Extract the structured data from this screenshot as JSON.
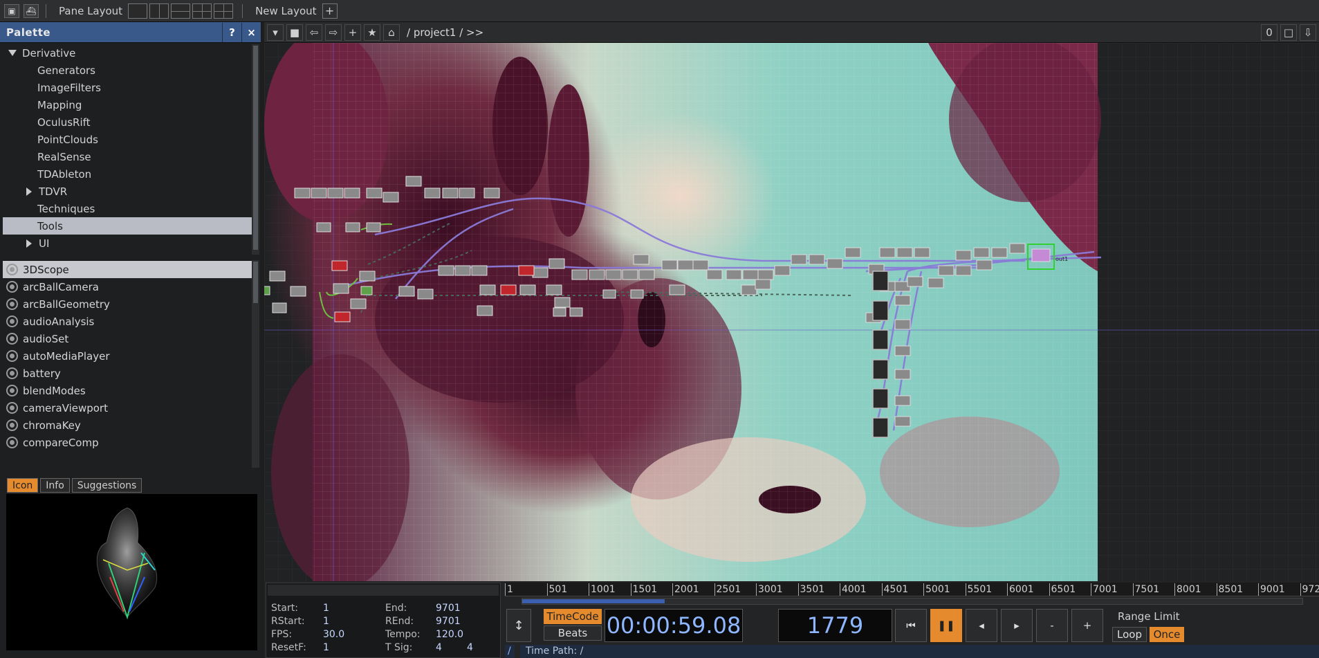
{
  "topbar": {
    "pane_layout_label": "Pane Layout",
    "new_layout_label": "New Layout"
  },
  "palette": {
    "title": "Palette",
    "help_label": "?",
    "close_label": "×",
    "tree": [
      {
        "label": "Derivative",
        "expanded": true
      },
      {
        "label": "Generators"
      },
      {
        "label": "ImageFilters"
      },
      {
        "label": "Mapping"
      },
      {
        "label": "OculusRift"
      },
      {
        "label": "PointClouds"
      },
      {
        "label": "RealSense"
      },
      {
        "label": "TDAbleton"
      },
      {
        "label": "TDVR",
        "collapsed": true
      },
      {
        "label": "Techniques"
      },
      {
        "label": "Tools",
        "selected": true
      },
      {
        "label": "UI",
        "collapsed": true
      }
    ],
    "components": [
      "3DScope",
      "arcBallCamera",
      "arcBallGeometry",
      "audioAnalysis",
      "audioSet",
      "autoMediaPlayer",
      "battery",
      "blendModes",
      "cameraViewport",
      "chromaKey",
      "compareComp"
    ],
    "selected_component": "3DScope",
    "info_tabs": [
      "Icon",
      "Info",
      "Suggestions"
    ],
    "active_info_tab": "Icon"
  },
  "network": {
    "path": "/ project1 / >>",
    "counter": "0",
    "output_label": "out1"
  },
  "timeline": {
    "start_label": "Start:",
    "start": "1",
    "end_label": "End:",
    "end": "9701",
    "rstart_label": "RStart:",
    "rstart": "1",
    "rend_label": "REnd:",
    "rend": "9701",
    "fps_label": "FPS:",
    "fps": "30.0",
    "tempo_label": "Tempo:",
    "tempo": "120.0",
    "resetf_label": "ResetF:",
    "resetf": "1",
    "tsig_label": "T Sig:",
    "tsig_a": "4",
    "tsig_b": "4",
    "ruler_ticks": [
      "1",
      "501",
      "1001",
      "1501",
      "2001",
      "2501",
      "3001",
      "3501",
      "4001",
      "4501",
      "5001",
      "5501",
      "6001",
      "6501",
      "7001",
      "7501",
      "8001",
      "8501",
      "9001",
      "972"
    ],
    "progress": 0.183,
    "timecode_label": "TimeCode",
    "beats_label": "Beats",
    "timecode": "00:00:59.08",
    "frame": "1779",
    "minus_label": "-",
    "plus_label": "+",
    "range_limit_label": "Range Limit",
    "loop_label": "Loop",
    "once_label": "Once",
    "time_path_label": "Time Path: /"
  },
  "colors": {
    "accent_orange": "#e68a2e",
    "palette_header": "#39598a",
    "wire": "#8a7ad8",
    "timecode_text": "#8fb7ff"
  }
}
